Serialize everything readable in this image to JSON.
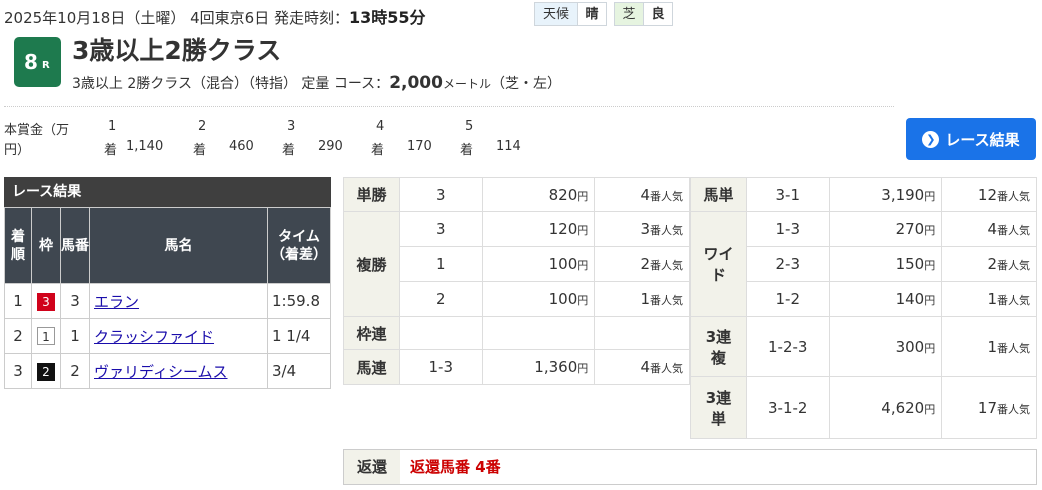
{
  "header": {
    "date_info": "2025年10月18日（土曜）  4回東京6日   発走時刻：",
    "start_time": "13時55分",
    "weather_label": "天候",
    "weather_value": "晴",
    "turf_label": "芝",
    "turf_value": "良"
  },
  "race": {
    "number": "8",
    "number_suffix": "R",
    "title": "3歳以上2勝クラス",
    "conditions": "3歳以上  2勝クラス（混合）（特指）  定量   コース：",
    "distance": "2,000",
    "unit": "メートル",
    "course_note": "（芝・左）"
  },
  "prize": {
    "label_line1": "本賞金（万",
    "label_line2": "円）",
    "items": [
      {
        "rank": "1",
        "suffix": "着",
        "value": "1,140"
      },
      {
        "rank": "2",
        "suffix": "着",
        "value": "460"
      },
      {
        "rank": "3",
        "suffix": "着",
        "value": "290"
      },
      {
        "rank": "4",
        "suffix": "着",
        "value": "170"
      },
      {
        "rank": "5",
        "suffix": "着",
        "value": "114"
      }
    ]
  },
  "result_button": {
    "label": "レース結果"
  },
  "results": {
    "title": "レース結果",
    "headers": {
      "rank": "着順",
      "waku": "枠",
      "umaban": "馬番",
      "horse": "馬名",
      "time": "タイム（着差）"
    },
    "rows": [
      {
        "rank": "1",
        "waku": "3",
        "waku_bg": "#d0021b",
        "waku_fg": "#ffffff",
        "umaban": "3",
        "horse": "エラン",
        "time": "1:59.8"
      },
      {
        "rank": "2",
        "waku": "1",
        "waku_bg": "#ffffff",
        "waku_fg": "#333333",
        "umaban": "1",
        "horse": "クラッシファイド",
        "time": "1 1/4"
      },
      {
        "rank": "3",
        "waku": "2",
        "waku_bg": "#111111",
        "waku_fg": "#ffffff",
        "umaban": "2",
        "horse": "ヴァリディシームス",
        "time": "3/4"
      }
    ]
  },
  "payout_left": {
    "tansho": {
      "label": "単勝",
      "rows": [
        {
          "num": "3",
          "amount": "820",
          "yen": "円",
          "pop": "4",
          "pop_suffix": "番人気"
        }
      ]
    },
    "fukusho": {
      "label": "複勝",
      "rows": [
        {
          "num": "3",
          "amount": "120",
          "yen": "円",
          "pop": "3",
          "pop_suffix": "番人気"
        },
        {
          "num": "1",
          "amount": "100",
          "yen": "円",
          "pop": "2",
          "pop_suffix": "番人気"
        },
        {
          "num": "2",
          "amount": "100",
          "yen": "円",
          "pop": "1",
          "pop_suffix": "番人気"
        }
      ]
    },
    "wakuren": {
      "label": "枠連"
    },
    "umaren": {
      "label": "馬連",
      "rows": [
        {
          "num": "1-3",
          "amount": "1,360",
          "yen": "円",
          "pop": "4",
          "pop_suffix": "番人気"
        }
      ]
    }
  },
  "payout_right": {
    "umatan": {
      "label": "馬単",
      "rows": [
        {
          "num": "3-1",
          "amount": "3,190",
          "yen": "円",
          "pop": "12",
          "pop_suffix": "番人気"
        }
      ]
    },
    "wide": {
      "label_line1": "ワイ",
      "label_line2": "ド",
      "rows": [
        {
          "num": "1-3",
          "amount": "270",
          "yen": "円",
          "pop": "4",
          "pop_suffix": "番人気"
        },
        {
          "num": "2-3",
          "amount": "150",
          "yen": "円",
          "pop": "2",
          "pop_suffix": "番人気"
        },
        {
          "num": "1-2",
          "amount": "140",
          "yen": "円",
          "pop": "1",
          "pop_suffix": "番人気"
        }
      ]
    },
    "trio": {
      "label_line1": "3連",
      "label_line2": "複",
      "rows": [
        {
          "num": "1-2-3",
          "amount": "300",
          "yen": "円",
          "pop": "1",
          "pop_suffix": "番人気"
        }
      ]
    },
    "trifecta": {
      "label_line1": "3連",
      "label_line2": "単",
      "rows": [
        {
          "num": "3-1-2",
          "amount": "4,620",
          "yen": "円",
          "pop": "17",
          "pop_suffix": "番人気"
        }
      ]
    }
  },
  "refund": {
    "label": "返還",
    "value": "返還馬番   4番"
  }
}
